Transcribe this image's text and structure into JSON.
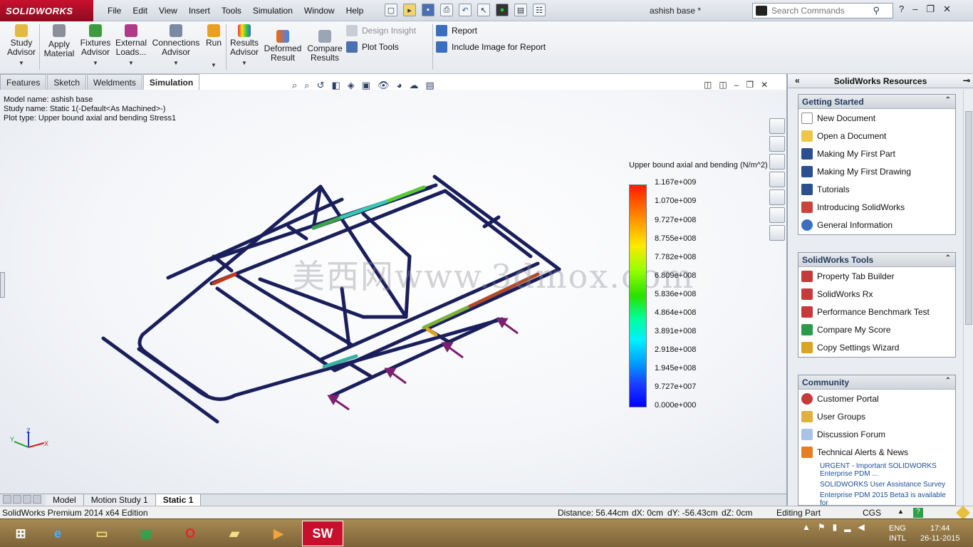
{
  "app": {
    "logo": "SOLIDWORKS",
    "document_title": "ashish base *"
  },
  "menu": [
    "File",
    "Edit",
    "View",
    "Insert",
    "Tools",
    "Simulation",
    "Window",
    "Help"
  ],
  "search": {
    "placeholder": "Search Commands"
  },
  "window_controls": {
    "help": "?",
    "minimize": "–",
    "restore": "❐",
    "close": "✕"
  },
  "commands": {
    "study_advisor": "Study Advisor",
    "apply_material": "Apply Material",
    "fixtures_advisor": "Fixtures Advisor",
    "external_loads": "External Loads...",
    "connections_advisor": "Connections Advisor",
    "run": "Run",
    "results_advisor": "Results Advisor",
    "deformed_result": "Deformed Result",
    "compare_results": "Compare Results",
    "design_insight": "Design Insight",
    "plot_tools": "Plot Tools",
    "report": "Report",
    "include_image": "Include Image for Report"
  },
  "tabs": [
    "Features",
    "Sketch",
    "Weldments",
    "Simulation"
  ],
  "active_tab": "Simulation",
  "study_info": {
    "model_name": "Model name: ashish base",
    "study_name": "Study name: Static 1(-Default<As Machined>-)",
    "plot_type": "Plot type: Upper bound axial and bending Stress1"
  },
  "legend": {
    "title": "Upper bound axial and bending (N/m^2)",
    "labels": [
      "1.167e+009",
      "1.070e+009",
      "9.727e+008",
      "8.755e+008",
      "7.782e+008",
      "6.809e+008",
      "5.836e+008",
      "4.864e+008",
      "3.891e+008",
      "2.918e+008",
      "1.945e+008",
      "9.727e+007",
      "0.000e+000"
    ]
  },
  "watermark": "美西网www.3dmox.com",
  "triad": {
    "x": "X",
    "y": "Y",
    "z": "Z"
  },
  "bottom_tabs": [
    "Model",
    "Motion Study 1",
    "Static 1"
  ],
  "active_bottom_tab": "Static 1",
  "status": {
    "edition": "SolidWorks Premium 2014 x64 Edition",
    "distance": "Distance: 56.44cm",
    "dx": "dX: 0cm",
    "dy": "dY: -56.43cm",
    "dz": "dZ: 0cm",
    "mode": "Editing Part",
    "units": "CGS"
  },
  "taskpane": {
    "title": "SolidWorks Resources",
    "getting_started": {
      "title": "Getting Started",
      "items": [
        "New Document",
        "Open a Document",
        "Making My First Part",
        "Making My First Drawing",
        "Tutorials",
        "Introducing SolidWorks",
        "General Information"
      ]
    },
    "tools": {
      "title": "SolidWorks Tools",
      "items": [
        "Property Tab Builder",
        "SolidWorks Rx",
        "Performance Benchmark Test",
        "Compare My Score",
        "Copy Settings Wizard"
      ]
    },
    "community": {
      "title": "Community",
      "items": [
        "Customer Portal",
        "User Groups",
        "Discussion Forum",
        "Technical Alerts & News"
      ],
      "news": [
        "URGENT - Important SOLIDWORKS Enterprise PDM ...",
        "SOLIDWORKS User Assistance Survey",
        "Enterprise PDM 2015 Beta3 is available for"
      ]
    }
  },
  "taskbar": {
    "lang": "ENG",
    "lang2": "INTL",
    "time": "17:44",
    "date": "26-11-2015",
    "sw_label": "SW"
  },
  "colors": {
    "frame": "#1a1f5c",
    "brand": "#c8102e",
    "load_arrow": "#7b1f6e"
  }
}
